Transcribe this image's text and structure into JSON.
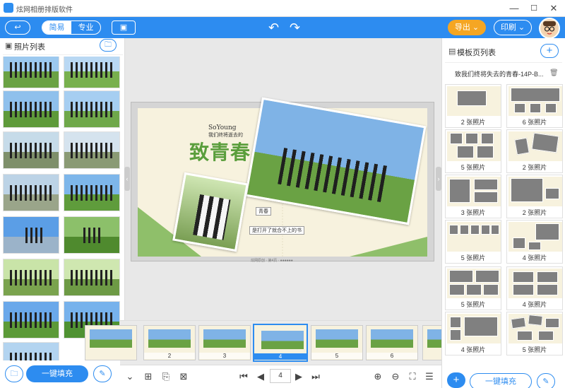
{
  "window": {
    "title": "炫网相册排版软件",
    "minimize": "—",
    "maximize": "☐",
    "close": "✕"
  },
  "toolbar": {
    "back_icon": "back-arrow-icon",
    "mode_simple": "简易",
    "mode_pro": "专业",
    "save_icon": "save-icon",
    "undo_icon": "undo-icon",
    "redo_icon": "redo-icon",
    "export_label": "导出",
    "print_label": "印刷"
  },
  "left_panel": {
    "title": "照片列表",
    "folder_icon": "folder-icon",
    "fill_label": "一键填充"
  },
  "canvas": {
    "brand": "SoYoung",
    "subtitle": "我们终将逝去的",
    "headline": "致青春",
    "tag1": "青春",
    "tag2": "是打开了就合不上的书",
    "footer": "炫网原创 · 第4页 · ●●●●●●"
  },
  "filmstrip": {
    "pages": [
      "2",
      "3",
      "4",
      "5",
      "6"
    ],
    "active": "4"
  },
  "bottom_bar": {
    "page_value": "4"
  },
  "right_panel": {
    "title": "模板页列表",
    "album_name": "致我们终将失去的青春-14P-B...",
    "templates": [
      {
        "caption": "2 张照片"
      },
      {
        "caption": "6 张照片"
      },
      {
        "caption": "5 张照片"
      },
      {
        "caption": "2 张照片"
      },
      {
        "caption": "3 张照片"
      },
      {
        "caption": "2 张照片"
      },
      {
        "caption": "5 张照片"
      },
      {
        "caption": "4 张照片"
      },
      {
        "caption": "5 张照片"
      },
      {
        "caption": "4 张照片"
      },
      {
        "caption": "4 张照片"
      },
      {
        "caption": "5 张照片"
      }
    ],
    "fill_label": "一键填充"
  },
  "colors": {
    "accent": "#2d8cf0",
    "export": "#f5a623",
    "paper": "#f7f2de",
    "green": "#5a9e3c"
  }
}
